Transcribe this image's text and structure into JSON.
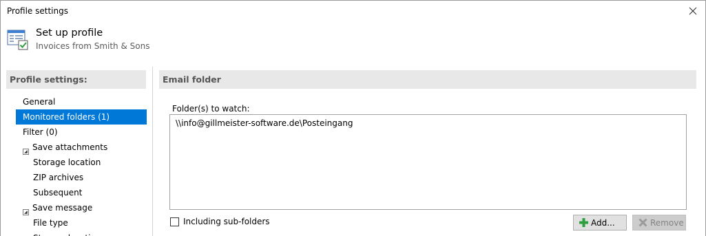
{
  "window": {
    "title": "Profile settings"
  },
  "header": {
    "title": "Set up profile",
    "subtitle": "Invoices from Smith & Sons"
  },
  "sidebar": {
    "heading": "Profile settings:",
    "items": [
      {
        "label": "General",
        "level": 0,
        "expander": false,
        "selected": false
      },
      {
        "label": "Monitored folders (1)",
        "level": 0,
        "expander": false,
        "selected": true
      },
      {
        "label": "Filter (0)",
        "level": 0,
        "expander": false,
        "selected": false
      },
      {
        "label": "Save attachments",
        "level": 0,
        "expander": true,
        "selected": false
      },
      {
        "label": "Storage location",
        "level": 1,
        "expander": false,
        "selected": false
      },
      {
        "label": "ZIP archives",
        "level": 1,
        "expander": false,
        "selected": false
      },
      {
        "label": "Subsequent",
        "level": 1,
        "expander": false,
        "selected": false
      },
      {
        "label": "Save message",
        "level": 0,
        "expander": true,
        "selected": false
      },
      {
        "label": "File type",
        "level": 1,
        "expander": false,
        "selected": false
      },
      {
        "label": "Storage location",
        "level": 1,
        "expander": false,
        "selected": false
      }
    ]
  },
  "panel": {
    "heading": "Email folder",
    "folders_label": "Folder(s) to watch:",
    "folders": [
      "\\\\info@gillmeister-software.de\\Posteingang"
    ],
    "subfolders_label": "Including sub-folders",
    "subfolders_checked": false,
    "add_label": "Add...",
    "remove_label": "Remove"
  },
  "colors": {
    "selection": "#0078d7",
    "header_band": "#e8e8e8",
    "add_icon": "#2e9e3e",
    "remove_icon": "#9a9a9a"
  }
}
